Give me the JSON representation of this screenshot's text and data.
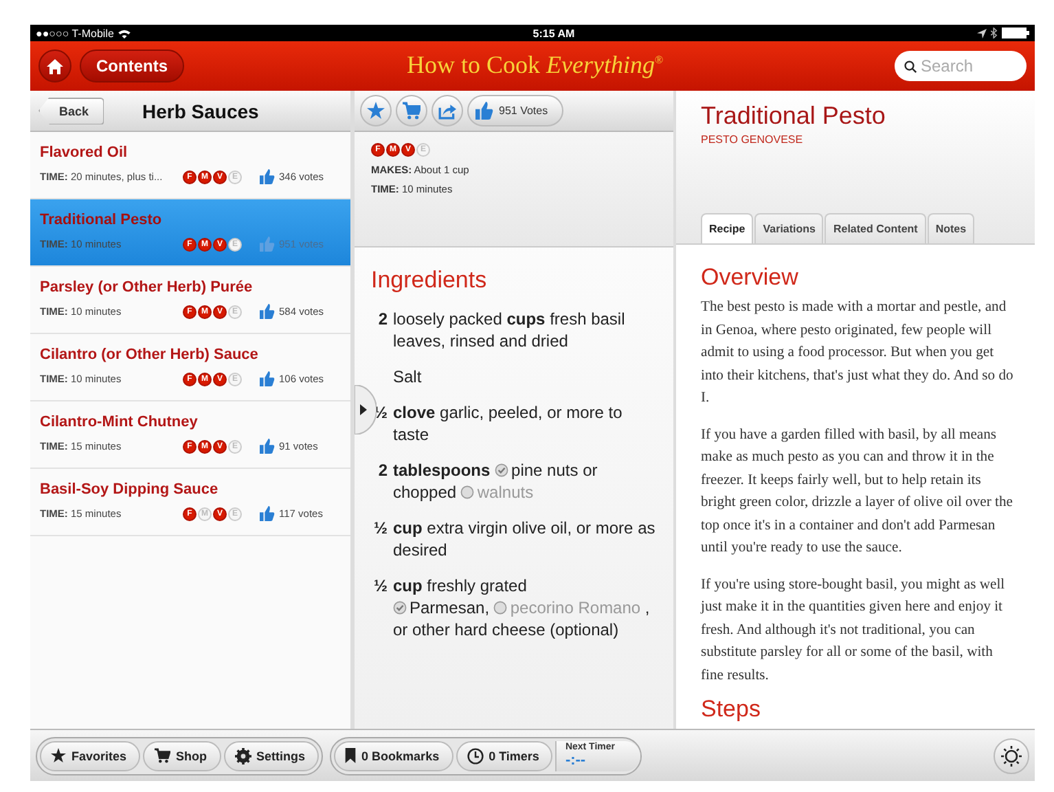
{
  "status_bar": {
    "carrier": "●●○○○ T-Mobile",
    "time": "5:15 AM"
  },
  "header": {
    "contents_button": "Contents",
    "logo": "How to Cook *Everything*$^{®}$",
    "search": {
      "placeholder": "Search"
    }
  },
  "recipe_list": {
    "back_button": "Back",
    "title": "Herb Sauces",
    "items": [
      {
        "title": "Flavored Oil",
        "time_label": "TIME:",
        "time": "20 minutes, plus ti...",
        "diets": [
          {
            "letter": "F",
            "on": true
          },
          {
            "letter": "M",
            "on": true
          },
          {
            "letter": "V",
            "on": true
          },
          {
            "letter": "E",
            "on": false
          }
        ],
        "votes": "346 votes",
        "selected": false
      },
      {
        "title": "Traditional Pesto",
        "time_label": "TIME:",
        "time": "10 minutes",
        "diets": [
          {
            "letter": "F",
            "on": true
          },
          {
            "letter": "M",
            "on": true
          },
          {
            "letter": "V",
            "on": true
          },
          {
            "letter": "E",
            "on": false
          }
        ],
        "votes": "951 votes",
        "selected": true
      },
      {
        "title": "Parsley (or Other Herb) Purée",
        "time_label": "TIME:",
        "time": "10 minutes",
        "diets": [
          {
            "letter": "F",
            "on": true
          },
          {
            "letter": "M",
            "on": true
          },
          {
            "letter": "V",
            "on": true
          },
          {
            "letter": "E",
            "on": false
          }
        ],
        "votes": "584 votes",
        "selected": false
      },
      {
        "title": "Cilantro (or Other Herb) Sauce",
        "time_label": "TIME:",
        "time": "10 minutes",
        "diets": [
          {
            "letter": "F",
            "on": true
          },
          {
            "letter": "M",
            "on": true
          },
          {
            "letter": "V",
            "on": true
          },
          {
            "letter": "E",
            "on": false
          }
        ],
        "votes": "106 votes",
        "selected": false
      },
      {
        "title": "Cilantro-Mint Chutney",
        "time_label": "TIME:",
        "time": "15 minutes",
        "diets": [
          {
            "letter": "F",
            "on": true
          },
          {
            "letter": "M",
            "on": true
          },
          {
            "letter": "V",
            "on": true
          },
          {
            "letter": "E",
            "on": false
          }
        ],
        "votes": "91 votes",
        "selected": false
      },
      {
        "title": "Basil-Soy Dipping Sauce",
        "time_label": "TIME:",
        "time": "15 minutes",
        "diets": [
          {
            "letter": "F",
            "on": true
          },
          {
            "letter": "M",
            "on": false
          },
          {
            "letter": "V",
            "on": true
          },
          {
            "letter": "E",
            "on": false
          }
        ],
        "votes": "117 votes",
        "selected": false
      }
    ]
  },
  "recipe_info": {
    "votes_button": "951 Votes",
    "diets": [
      {
        "letter": "F",
        "on": true
      },
      {
        "letter": "M",
        "on": true
      },
      {
        "letter": "V",
        "on": true
      },
      {
        "letter": "E",
        "on": false
      }
    ],
    "makes_label": "MAKES:",
    "makes": "About 1 cup",
    "time_label": "TIME:",
    "time": "10 minutes"
  },
  "ingredients": {
    "heading": "Ingredients",
    "items": [
      {
        "qty": "2",
        "parts": [
          {
            "kind": "text",
            "text": "loosely packed **cups** fresh basil leaves, rinsed and dried"
          }
        ]
      },
      {
        "parts": [
          {
            "kind": "text",
            "text": "Salt"
          }
        ]
      },
      {
        "qty": "½",
        "parts": [
          {
            "kind": "text",
            "text": "**clove** garlic, peeled, or more to taste"
          }
        ]
      },
      {
        "qty": "2",
        "parts": [
          {
            "kind": "text",
            "text": "**tablespoons**"
          },
          {
            "kind": "option",
            "text": "pine nuts",
            "checked": true
          },
          {
            "kind": "text",
            "text": "or chopped"
          },
          {
            "kind": "option",
            "text": "walnuts",
            "checked": false
          }
        ]
      },
      {
        "qty": "½",
        "parts": [
          {
            "kind": "text",
            "text": "**cup** extra virgin olive oil, or more as desired"
          }
        ]
      },
      {
        "qty": "½",
        "parts": [
          {
            "kind": "text",
            "text": "**cup** freshly grated"
          },
          {
            "kind": "option",
            "text": "Parmesan,",
            "checked": true
          },
          {
            "kind": "option",
            "text": "pecorino Romano",
            "checked": false
          },
          {
            "kind": "text",
            "text": ", or other hard cheese (optional)"
          }
        ]
      }
    ]
  },
  "detail": {
    "title": "Traditional Pesto",
    "subtitle": "PESTO GENOVESE",
    "tabs": [
      {
        "label": "Recipe",
        "selected": true
      },
      {
        "label": "Variations",
        "selected": false
      },
      {
        "label": "Related Content",
        "selected": false
      },
      {
        "label": "Notes",
        "selected": false
      }
    ],
    "overview_heading": "Overview",
    "paragraphs": [
      "The best pesto is made with a mortar and pestle, and in Genoa, where pesto originated, few people will admit to using a food processor. But when you get into their kitchens, that's just what they do. And so do I.",
      "If you have a garden filled with basil, by all means make as much pesto as you can and throw it in the freezer. It keeps fairly well, but to help retain its bright green color, drizzle a layer of olive oil over the top once it's in a container and don't add Parmesan until you're ready to use the sauce.",
      "If you're using store-bought basil, you might as well just make it in the quantities given here and enjoy it fresh. And although it's not traditional, you can substitute parsley for all or some of the basil, with fine results."
    ],
    "steps_heading": "Steps"
  },
  "toolbar": {
    "favorites": "Favorites",
    "shop": "Shop",
    "settings": "Settings",
    "bookmarks": "0 Bookmarks",
    "timers": "0 Timers",
    "next_timer_label": "Next Timer",
    "next_timer": "-:--"
  }
}
